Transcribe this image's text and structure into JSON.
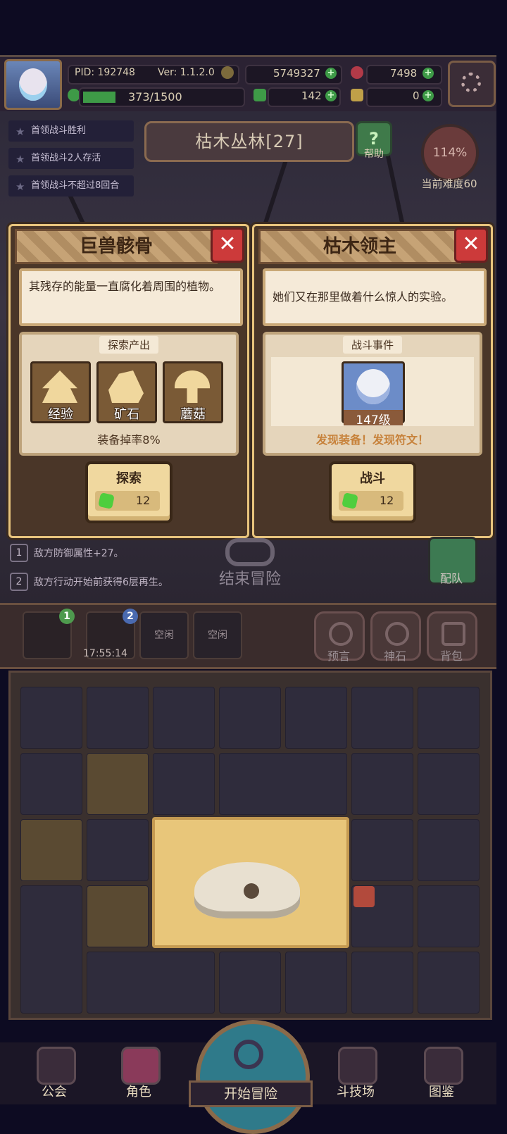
{
  "player": {
    "pid": "PID: 192748",
    "version": "Ver: 1.1.2.0",
    "gold": "5749327",
    "red_gem": "7498",
    "stamina": "373/1500",
    "clover": "142",
    "keys": "0"
  },
  "quests": [
    "首领战斗胜利",
    "首领战斗2人存活",
    "首领战斗不超过8回合"
  ],
  "level": {
    "name": "枯木丛林[27]",
    "help_label": "帮助"
  },
  "difficulty": {
    "percent": "114%",
    "label": "当前难度60"
  },
  "cards": {
    "explore": {
      "title": "巨兽骸骨",
      "description": "其残存的能量一直腐化着周围的植物。",
      "panel_title": "探索产出",
      "resources": [
        "经验",
        "矿石",
        "蘑菇"
      ],
      "drop_rate": "装备掉率8%",
      "action_label": "探索",
      "cost": "12"
    },
    "battle": {
      "title": "枯木领主",
      "description": "她们又在那里做着什么惊人的实验。",
      "panel_title": "战斗事件",
      "boss_level": "147级",
      "findings": "发现装备！发现符文！",
      "action_label": "战斗",
      "cost": "12"
    }
  },
  "buffs": [
    {
      "num": "1",
      "text": "敌方防御属性+27。"
    },
    {
      "num": "2",
      "text": "敌方行动开始前获得6层再生。"
    }
  ],
  "end_adventure": "结束冒险",
  "team_label": "配队",
  "slots": {
    "badge1": "1",
    "badge2": "2",
    "timer": "17:55:14",
    "empty1": "空闲",
    "empty2": "空闲"
  },
  "tools": [
    "预言",
    "神石",
    "背包"
  ],
  "nav": {
    "guild": "公会",
    "character": "角色",
    "start": "开始冒险",
    "arena": "斗技场",
    "codex": "图鉴"
  },
  "colors": {
    "accent_gold": "#e8c47d",
    "gem_green": "#4fce3e",
    "close_red": "#cc3a3a",
    "find_orange": "#c7823b"
  }
}
